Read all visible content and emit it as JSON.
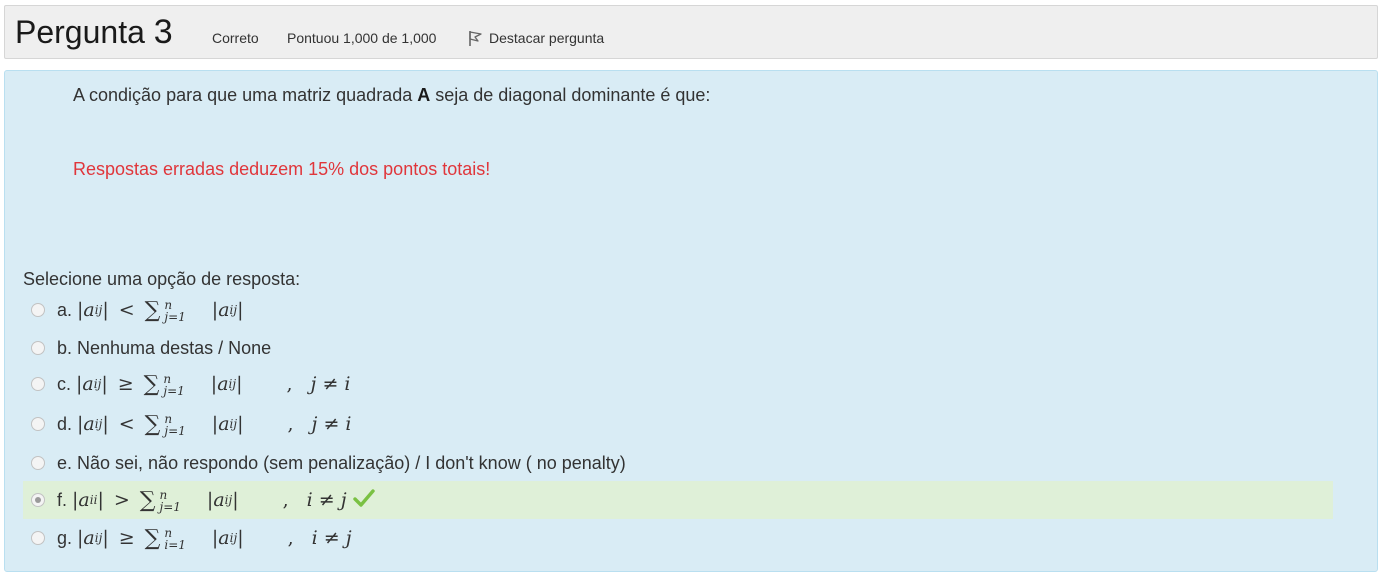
{
  "info": {
    "title_label": "Pergunta",
    "title_number": "3",
    "state": "Correto",
    "grade": "Pontuou 1,000 de 1,000",
    "flag_label": "Destacar pergunta"
  },
  "question": {
    "text_before": "A condição para que uma matriz quadrada ",
    "text_bold": "A",
    "text_after": " seja de diagonal dominante é que:",
    "warning": "Respostas erradas deduzem 15% dos pontos totais!",
    "prompt": "Selecione uma opção de resposta:"
  },
  "options": {
    "a": {
      "letter": "a.",
      "lhs_sub": "ij",
      "op": "<",
      "sum_from": "j=1",
      "sum_to": "n",
      "rhs_sub": "ij",
      "cond": ""
    },
    "b": {
      "letter": "b.",
      "text": "Nenhuma destas / None"
    },
    "c": {
      "letter": "c.",
      "lhs_sub": "ij",
      "op": "≥",
      "sum_from": "j=1",
      "sum_to": "n",
      "rhs_sub": "ij",
      "cond": "j ≠ i"
    },
    "d": {
      "letter": "d.",
      "lhs_sub": "ij",
      "op": "<",
      "sum_from": "j=1",
      "sum_to": "n",
      "rhs_sub": "ij",
      "cond": "j ≠ i"
    },
    "e": {
      "letter": "e.",
      "text": "Não sei, não respondo (sem penalização) / I don't know ( no penalty)"
    },
    "f": {
      "letter": "f.",
      "lhs_sub": "ii",
      "op": ">",
      "sum_from": "j=1",
      "sum_to": "n",
      "rhs_sub": "ij",
      "cond": "i ≠ j",
      "selected": true,
      "correct": true
    },
    "g": {
      "letter": "g.",
      "lhs_sub": "ij",
      "op": "≥",
      "sum_from": "i=1",
      "sum_to": "n",
      "rhs_sub": "ij",
      "cond": "i ≠ j"
    }
  },
  "colors": {
    "info_bg": "#efefef",
    "content_bg": "#d9ecf5",
    "correct_bg": "#dff0d8",
    "warning": "#e0363b",
    "check": "#7ac143"
  },
  "icons": {
    "flag": "flag-icon",
    "check": "check-icon"
  }
}
